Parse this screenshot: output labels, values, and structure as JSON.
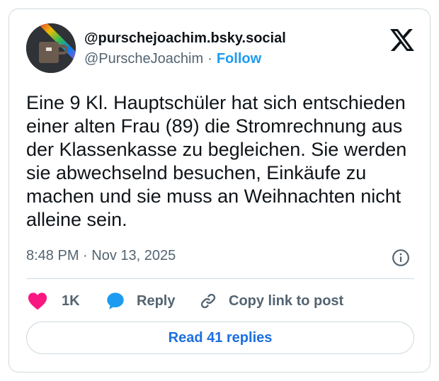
{
  "post": {
    "author_display": "@purschejoachim.bsky.social",
    "author_handle": "@PurscheJoachim",
    "separator": "·",
    "follow_label": "Follow",
    "text": "Eine 9 Kl. Hauptschüler hat sich entschieden einer alten Frau (89) die Stromrechnung aus der Klassenkasse zu begleichen. Sie werden sie abwechselnd besuchen, Einkäufe zu machen und sie muss an Weihnachten nicht alleine sein.",
    "time": "8:48 PM",
    "date": "Nov 13, 2025"
  },
  "actions": {
    "like_count": "1K",
    "reply_label": "Reply",
    "copy_label": "Copy link to post"
  },
  "footer": {
    "read_replies_label": "Read 41 replies"
  },
  "icons": {
    "brand": "x-logo-icon",
    "info": "info-icon",
    "like": "heart-icon",
    "reply": "speech-bubble-icon",
    "copy": "link-icon"
  },
  "colors": {
    "text": "#0f1419",
    "secondary": "#536471",
    "accent": "#1d9bf0",
    "like": "#f91880",
    "border": "#cfd9de"
  }
}
